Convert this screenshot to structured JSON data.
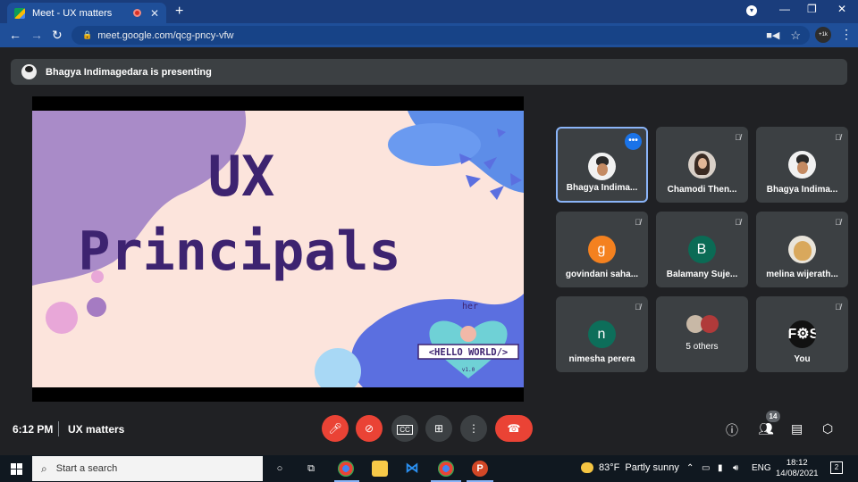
{
  "browser": {
    "tab_title": "Meet - UX matters",
    "tab_close": "✕",
    "new_tab": "+",
    "url": "meet.google.com/qcg-pncy-vfw",
    "profile_text": "+1k"
  },
  "banner": {
    "text": "Bhagya Indimagedara is presenting"
  },
  "slide": {
    "title_line1": "UX",
    "title_line2": "Principals",
    "badge_top": "her",
    "badge_main": "<HELLO WORLD/>",
    "badge_version": "v1.0",
    "colors": {
      "bg": "#fce4dc",
      "purple": "#a98bc8",
      "blue": "#5d8de8",
      "navy": "#5b6fe0",
      "text": "#3d2370"
    }
  },
  "participants": [
    {
      "name": "Bhagya Indima...",
      "avatar": "photo-m",
      "muted": false,
      "active": true
    },
    {
      "name": "Chamodi Then...",
      "avatar": "photo-f",
      "muted": true
    },
    {
      "name": "Bhagya Indima...",
      "avatar": "photo-m",
      "muted": true
    },
    {
      "name": "govindani saha...",
      "avatar": "letter",
      "letter": "g",
      "color": "#f4811f",
      "muted": true
    },
    {
      "name": "Balamany Suje...",
      "avatar": "letter",
      "letter": "B",
      "color": "#0b6b55",
      "muted": true
    },
    {
      "name": "melina wijerath...",
      "avatar": "dog",
      "muted": true
    },
    {
      "name": "nimesha perera",
      "avatar": "letter",
      "letter": "n",
      "color": "#0d6e5a",
      "muted": true
    },
    {
      "name": "5 others",
      "avatar": "group",
      "muted": false
    },
    {
      "name": "You",
      "avatar": "fass",
      "logo": "F⚙SS",
      "muted": true
    }
  ],
  "meeting": {
    "time": "6:12 PM",
    "title": "UX matters",
    "people_count": "14"
  },
  "taskbar": {
    "search_placeholder": "Start a search",
    "weather_temp": "83°F",
    "weather_desc": "Partly sunny",
    "language": "ENG",
    "time": "18:12",
    "date": "14/08/2021",
    "notifications": "2"
  }
}
